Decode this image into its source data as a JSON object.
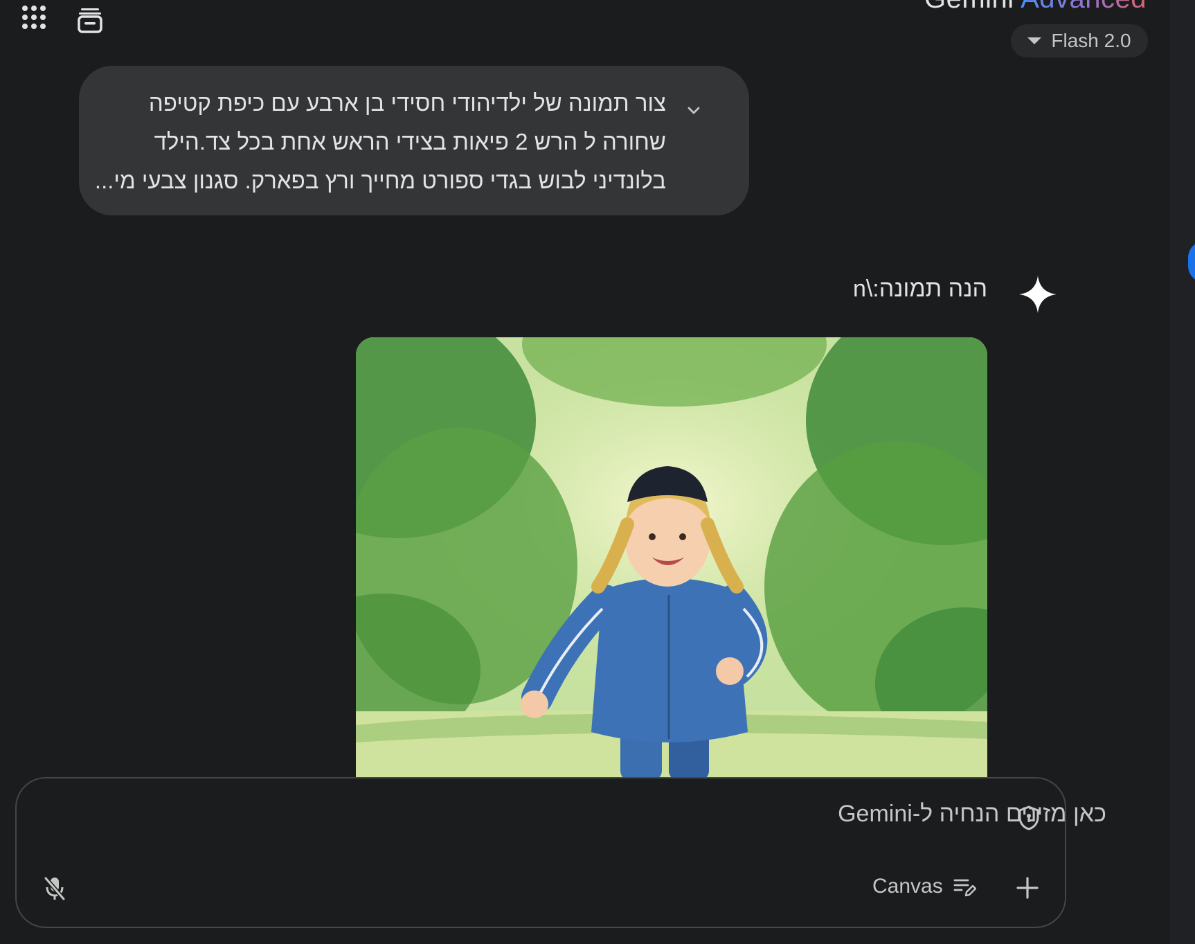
{
  "header": {
    "brand_name": "Gemini",
    "brand_tier": "Advanced",
    "model_label": "Flash 2.0"
  },
  "icons": {
    "apps": "apps-grid-icon",
    "history": "history-icon",
    "model_caret": "caret-down-icon",
    "expand": "chevron-down-icon",
    "assistant": "gemini-spark-icon",
    "shield": "shield-icon",
    "add": "plus-icon",
    "canvas": "canvas-icon",
    "mic": "mic-off-icon"
  },
  "prompt": {
    "lines": [
      "צור תמונה של ילדיהודי חסידי בן ארבע עם כיפת קטיפה",
      "שחורה ל הרש 2 פיאות בצידי הראש אחת בכל צד.הילד",
      "בלונדיני לבוש בגדי ספורט מחייך ורץ בפארק. סגנון צבעי מי..."
    ]
  },
  "response": {
    "text": "הנה תמונה:\\n"
  },
  "input": {
    "placeholder": "כאן מזינים הנחיה ל-Gemini",
    "canvas_label": "Canvas"
  },
  "colors": {
    "background": "#1b1c1d",
    "bubble": "#333537",
    "chip": "#282a2c",
    "text": "#e3e3e3",
    "muted_text": "#c4c7c5",
    "accent_blue": "#4b90ff",
    "accent_purple": "#9b72cb",
    "accent_red": "#d96570"
  }
}
